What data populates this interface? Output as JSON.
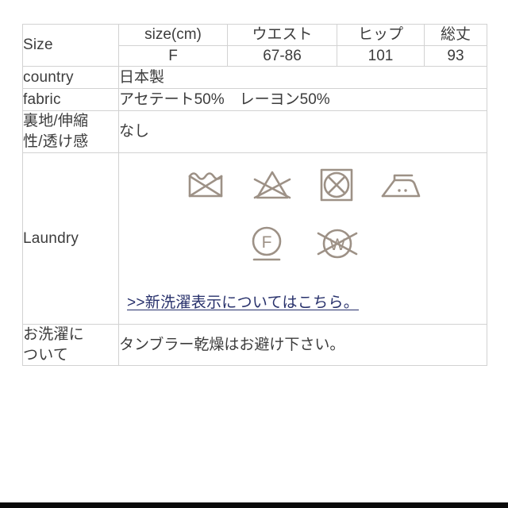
{
  "table": {
    "rows": {
      "size": {
        "label": "Size",
        "headers": [
          "size(cm)",
          "ウエスト",
          "ヒップ",
          "総丈"
        ],
        "values": [
          "F",
          "67-86",
          "101",
          "93"
        ]
      },
      "country": {
        "label": "country",
        "value": "日本製"
      },
      "fabric": {
        "label": "fabric",
        "value": "アセテート50%　レーヨン50%"
      },
      "lining": {
        "label": "裏地/伸縮\n性/透け感",
        "value": "なし"
      },
      "laundry": {
        "label": "Laundry",
        "symbols_row1": [
          "do-not-wash-icon",
          "do-not-bleach-icon",
          "tumble-dry-icon",
          "iron-medium-icon"
        ],
        "symbols_row2": [
          "dryclean-petroleum-icon",
          "do-not-wetclean-icon"
        ],
        "symbol_letters": {
          "dryclean": "F",
          "wetclean": "W"
        },
        "link_text": ">>新洗濯表示についてはこちら。"
      },
      "care": {
        "label": "お洗濯に\nついて",
        "value": "タンブラー乾燥はお避け下さい。"
      }
    }
  },
  "colors": {
    "border": "#d2d2d2",
    "text": "#3c3c3c",
    "symbol": "#9d9186",
    "link": "#27306b"
  }
}
